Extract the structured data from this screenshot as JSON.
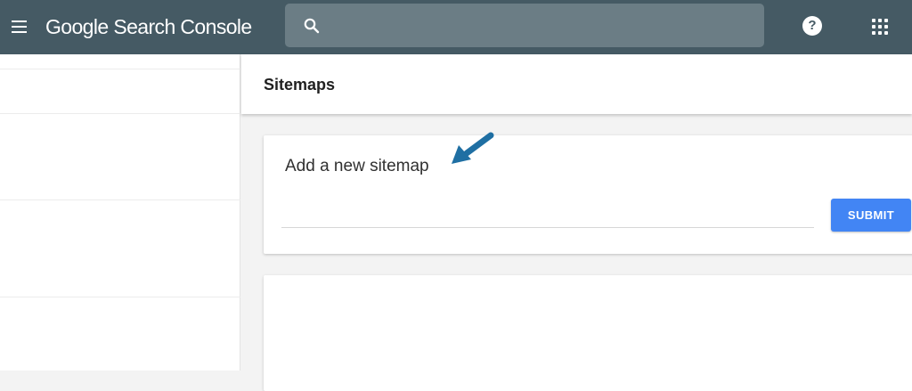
{
  "header": {
    "app_title": "Google Search Console",
    "help_glyph": "?"
  },
  "search": {
    "value": ""
  },
  "main": {
    "page_title": "Sitemaps",
    "add_sitemap_card": {
      "title": "Add a new sitemap",
      "input_value": "",
      "submit_label": "SUBMIT"
    }
  },
  "icons": {
    "menu": "hamburger-menu-icon",
    "search": "search-icon",
    "help": "help-icon",
    "apps": "apps-grid-icon",
    "annotation": "arrow-pointer-icon"
  },
  "colors": {
    "topbar": "#455a64",
    "search_box": "#6b7d85",
    "submit_button": "#4285f4",
    "annotation_arrow": "#1f6fa3"
  }
}
